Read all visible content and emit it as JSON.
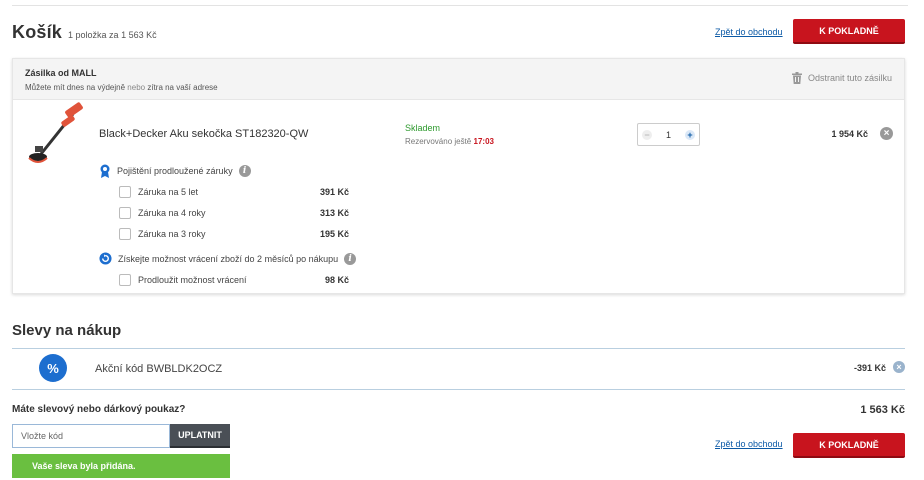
{
  "header": {
    "title": "Košík",
    "summary": "1 položka za 1 563 Kč",
    "back_link": "Zpět do obchodu",
    "checkout_label": "K POKLADNĚ"
  },
  "shipment": {
    "title": "Zásilka od MALL",
    "subtitle_part1": "Můžete mít dnes na výdejně",
    "subtitle_or": "nebo",
    "subtitle_part2": "zítra na vaší adrese",
    "remove_label": "Odstranit tuto zásilku"
  },
  "product": {
    "name": "Black+Decker Aku sekočka ST182320-QW",
    "stock": "Skladem",
    "reserved_label": "Rezervováno ještě",
    "reserved_time": "17:03",
    "quantity": "1",
    "price": "1 954 Kč"
  },
  "warranty": {
    "title": "Pojištění prodloužené záruky",
    "options": [
      {
        "label": "Záruka na 5 let",
        "price": "391 Kč"
      },
      {
        "label": "Záruka na 4 roky",
        "price": "313 Kč"
      },
      {
        "label": "Záruka na 3 roky",
        "price": "195 Kč"
      }
    ]
  },
  "returns": {
    "title": "Získejte možnost vrácení zboží do 2 měsíců po nákupu",
    "option_label": "Prodloužit možnost vrácení",
    "option_price": "98 Kč"
  },
  "discounts": {
    "title": "Slevy na nákup",
    "percent_symbol": "%",
    "code_label": "Akční kód BWBLDK2OCZ",
    "code_amount": "-391 Kč"
  },
  "voucher": {
    "question": "Máte slevový nebo dárkový poukaz?",
    "placeholder": "Vložte kód",
    "apply_label": "UPLATNIT",
    "success": "Vaše sleva byla přidána."
  },
  "footer": {
    "total": "1 563 Kč",
    "back_link": "Zpět do obchodu",
    "checkout_label": "K POKLADNĚ"
  },
  "icons": {
    "remove": "×",
    "info": "i",
    "plus": "+",
    "minus": "−"
  },
  "colors": {
    "accent_red": "#c8141e",
    "link_blue": "#0c5aa6",
    "success_green": "#6abf40",
    "stock_green": "#2e9a2e",
    "percent_blue": "#1d6ecf"
  }
}
